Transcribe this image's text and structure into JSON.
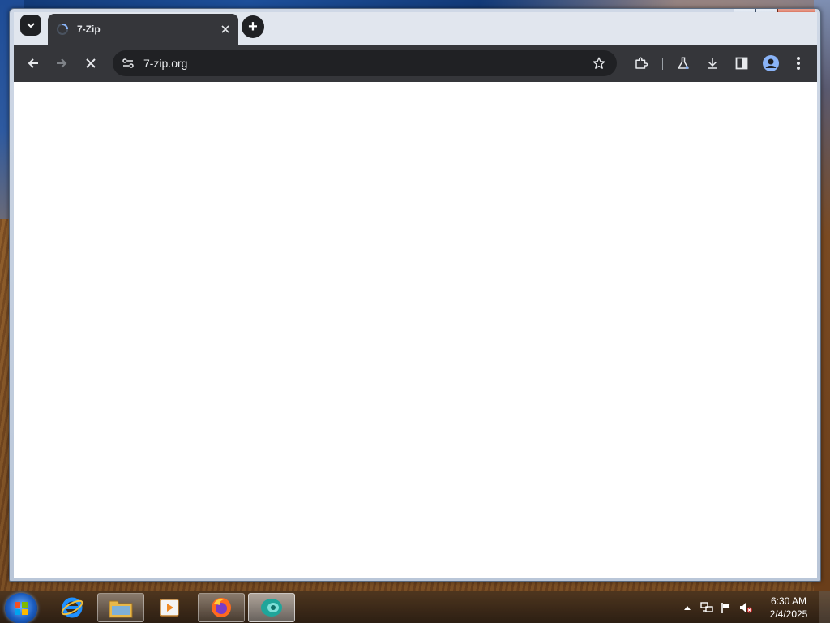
{
  "browser": {
    "tab": {
      "title": "7-Zip",
      "state": "loading"
    },
    "new_tab_label": "+",
    "address_bar": {
      "url": "7-zip.org"
    },
    "toolbar": {
      "back": "arrow-left-icon",
      "forward": "arrow-right-icon",
      "stop": "close-icon",
      "site_info": "tune-icon",
      "bookmark": "star-icon",
      "extensions": "puzzle-icon",
      "labs": "flask-icon",
      "downloads": "download-icon",
      "side_panel": "sidebar-icon",
      "profile": "avatar-icon",
      "menu": "more-vert-icon"
    },
    "content": {
      "background": "#ffffff"
    }
  },
  "window": {
    "controls": [
      "minimize",
      "maximize",
      "close"
    ]
  },
  "taskbar": {
    "pinned": [
      "Internet Explorer",
      "Windows Explorer",
      "Media Player",
      "Firefox",
      "Chrome"
    ],
    "tray": {
      "icons": [
        "show-hidden-icon",
        "network-icon",
        "action-center-flag-icon",
        "volume-muted-icon"
      ],
      "time": "6:30 AM",
      "date": "2/4/2025"
    }
  },
  "colors": {
    "chrome_dark": "#202124",
    "toolbar": "#35363a",
    "accent_blue": "#8ab4f8"
  }
}
